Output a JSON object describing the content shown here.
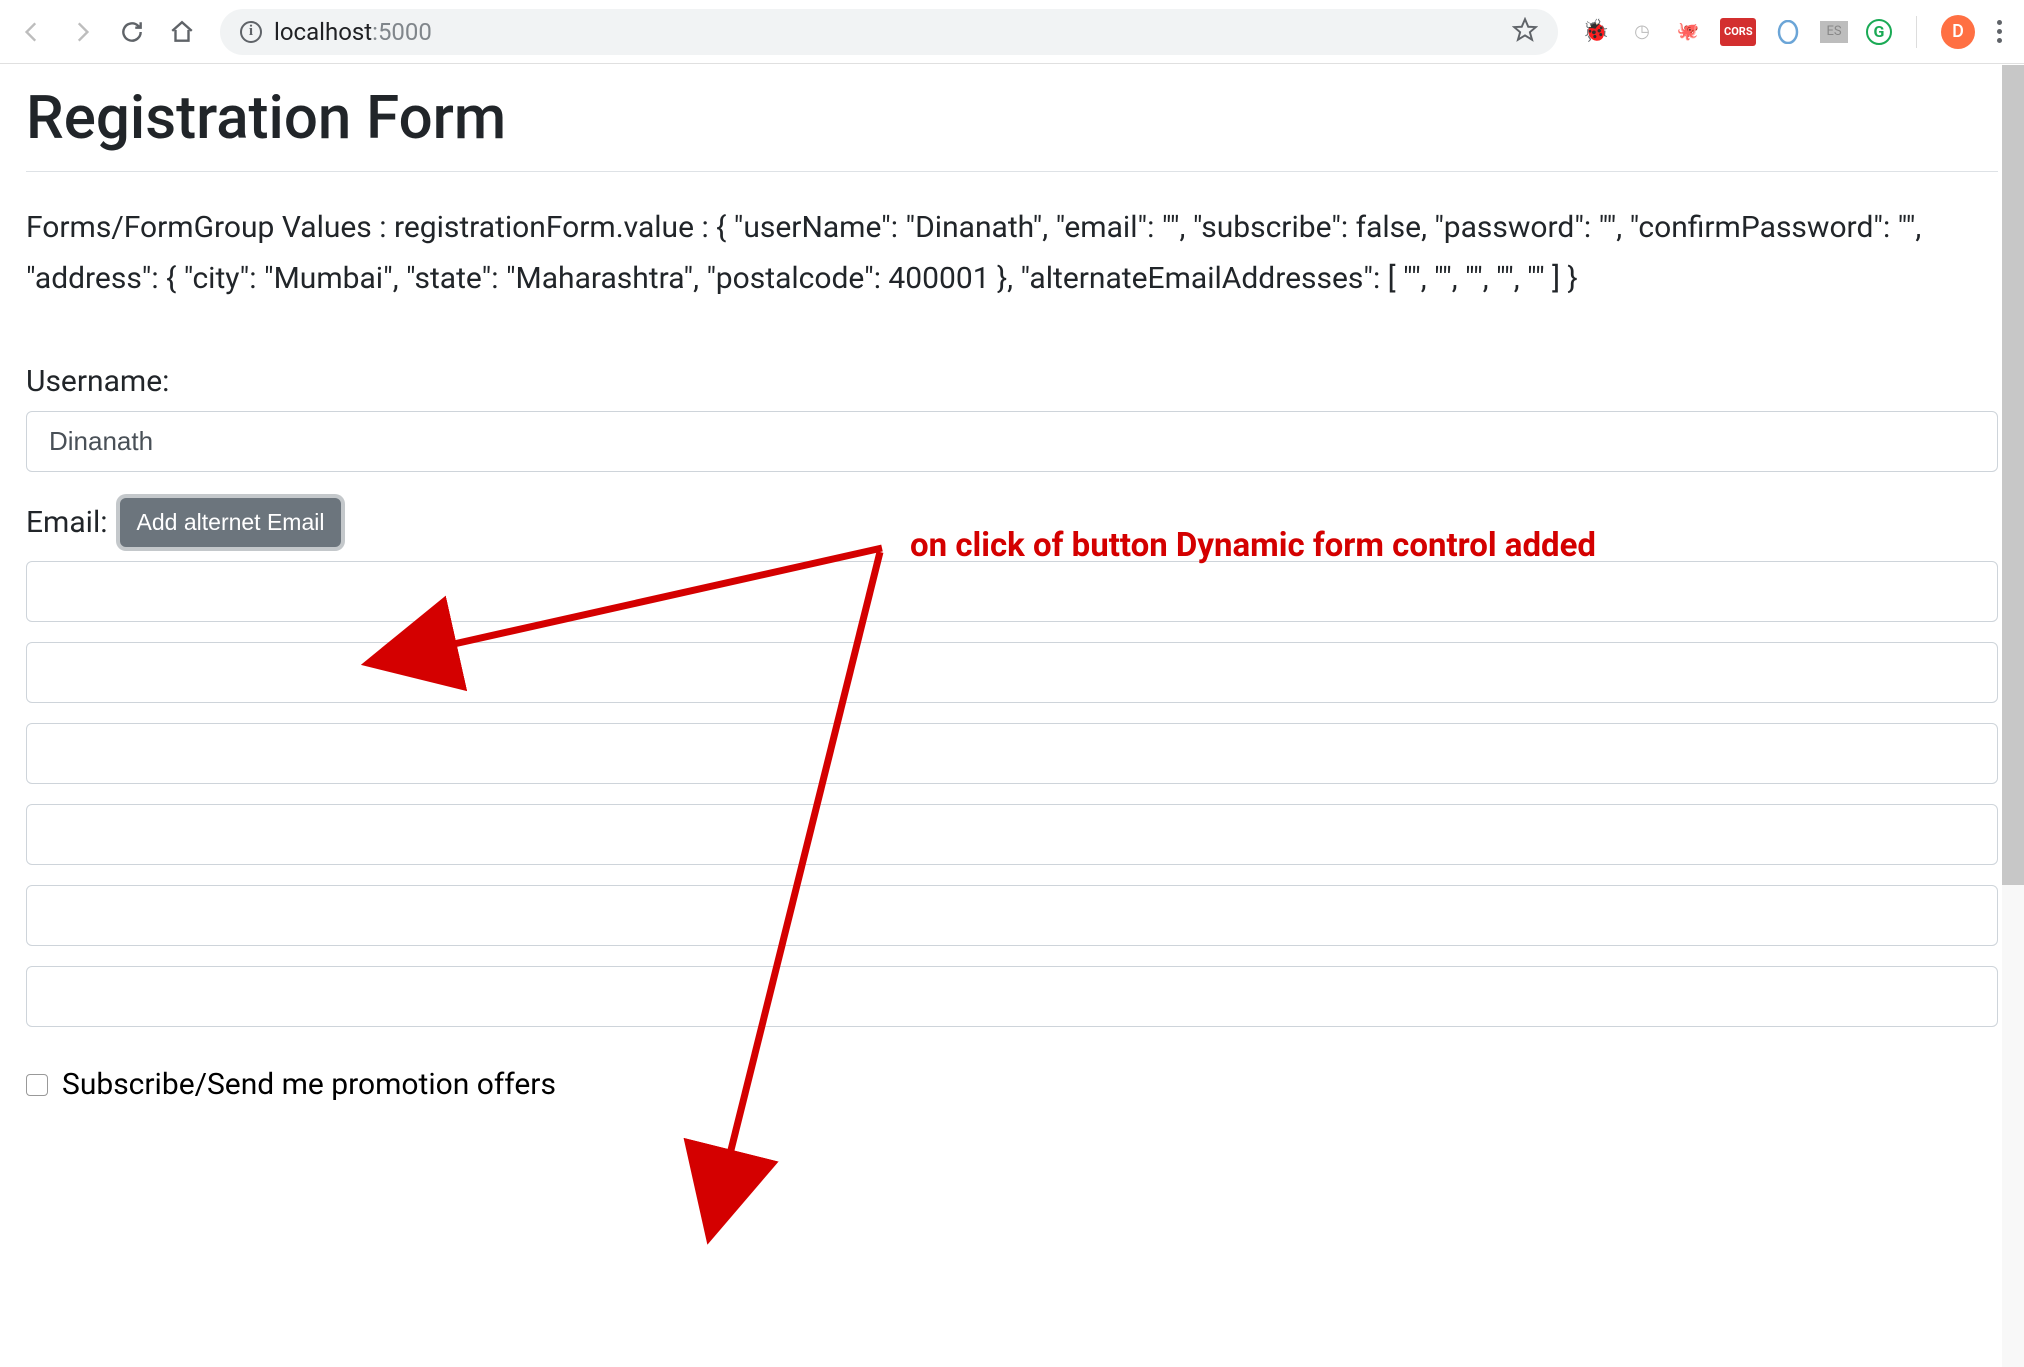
{
  "browser": {
    "url_host": "localhost",
    "url_port": ":5000",
    "avatar_letter": "D",
    "ext_cors": "CORS",
    "ext_es": "ES",
    "ext_g": "G"
  },
  "page": {
    "title": "Registration Form",
    "form_values_prefix": "Forms/FormGroup Values : registrationForm.value : ",
    "form_values_json": "{ \"userName\": \"Dinanath\", \"email\": \"\", \"subscribe\": false, \"password\": \"\", \"confirmPassword\": \"\", \"address\": { \"city\": \"Mumbai\", \"state\": \"Maharashtra\", \"postalcode\": 400001 }, \"alternateEmailAddresses\": [ \"\", \"\", \"\", \"\", \"\" ] }",
    "labels": {
      "username": "Username:",
      "email": "Email:",
      "subscribe": "Subscribe/Send me promotion offers"
    },
    "buttons": {
      "add_alternate_email": "Add alternet Email"
    },
    "values": {
      "username": "Dinanath",
      "email0": "",
      "email1": "",
      "email2": "",
      "email3": "",
      "email4": "",
      "email5": ""
    }
  },
  "annotation": {
    "text": "on click of button Dynamic form control added"
  },
  "form_data": {
    "userName": "Dinanath",
    "email": "",
    "subscribe": false,
    "password": "",
    "confirmPassword": "",
    "address": {
      "city": "Mumbai",
      "state": "Maharashtra",
      "postalcode": 400001
    },
    "alternateEmailAddresses": [
      "",
      "",
      "",
      "",
      ""
    ]
  }
}
